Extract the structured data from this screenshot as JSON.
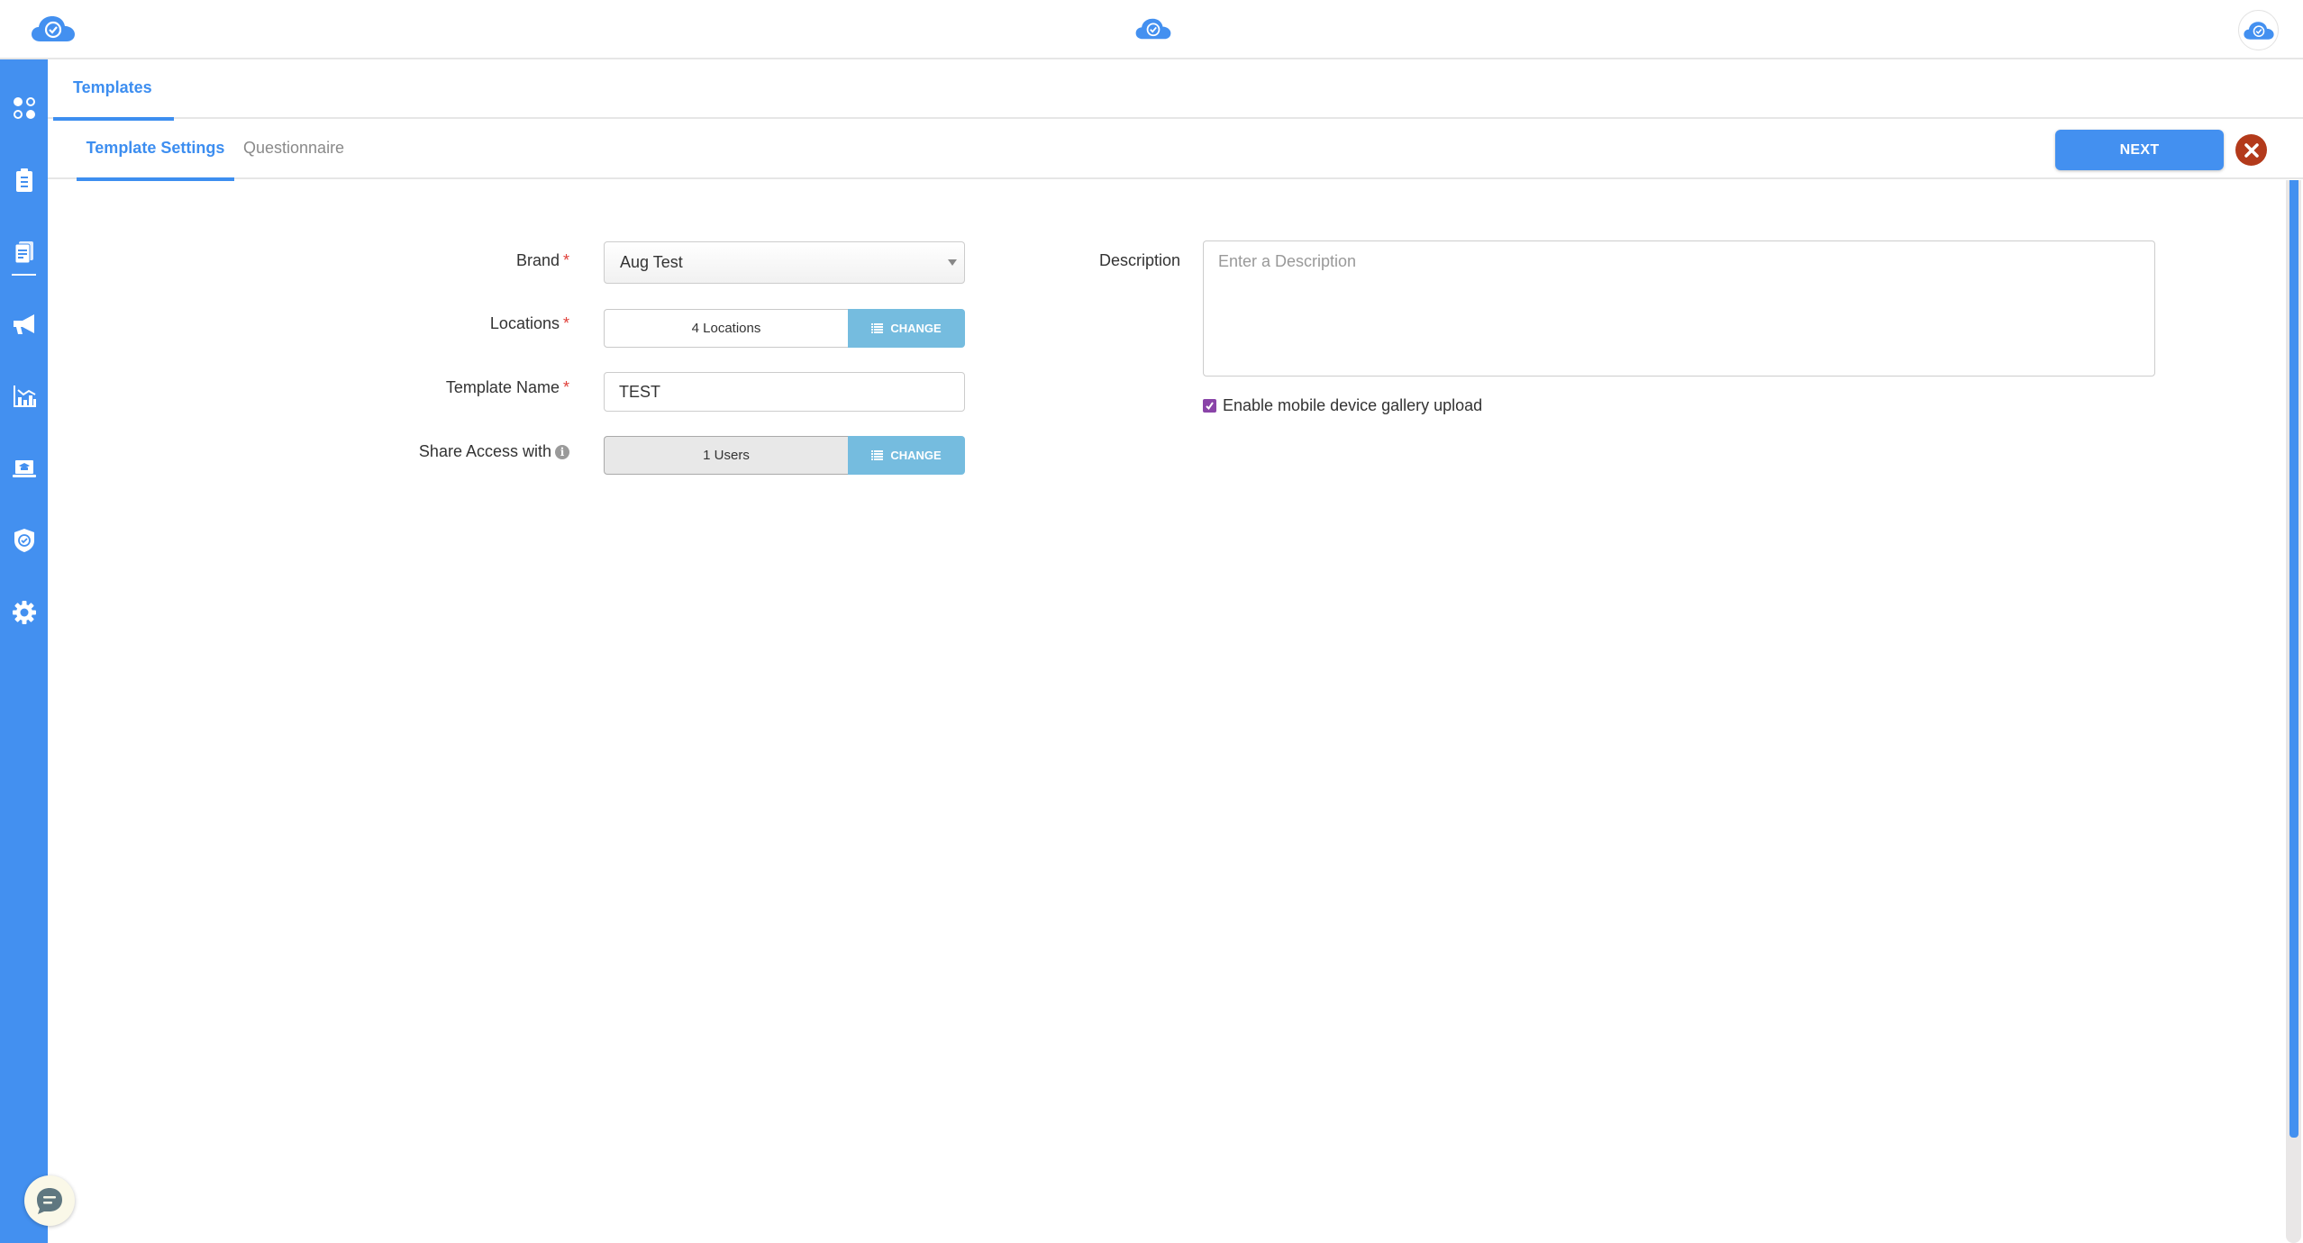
{
  "header": {
    "logo_icon": "cloud-check-logo",
    "center_logo_icon": "cloud-check-logo",
    "avatar_icon": "cloud-check-avatar"
  },
  "colors": {
    "brand_blue": "#4390f0",
    "tab_blue": "#3d8ef0",
    "change_button": "#75bcdf",
    "close_red": "#b33a1b",
    "checkbox_purple": "#8a44a8",
    "required_red": "#e0403a"
  },
  "sidebar": {
    "items": [
      {
        "icon": "dashboard-icon",
        "label": "Dashboard"
      },
      {
        "icon": "clipboard-icon",
        "label": "Audits"
      },
      {
        "icon": "documents-icon",
        "label": "Templates",
        "active": true
      },
      {
        "icon": "megaphone-icon",
        "label": "Announcements"
      },
      {
        "icon": "analytics-icon",
        "label": "Reports"
      },
      {
        "icon": "training-icon",
        "label": "Training"
      },
      {
        "icon": "shield-check-icon",
        "label": "Compliance"
      },
      {
        "icon": "gear-icon",
        "label": "Settings"
      }
    ]
  },
  "tabs": {
    "main": "Templates",
    "sub": [
      {
        "label": "Template Settings",
        "active": true
      },
      {
        "label": "Questionnaire",
        "active": false
      }
    ]
  },
  "actions": {
    "next_label": "NEXT",
    "close_icon": "close-icon"
  },
  "form": {
    "brand": {
      "label": "Brand",
      "required_mark": "*",
      "value": "Aug Test"
    },
    "locations": {
      "label": "Locations",
      "required_mark": "*",
      "value": "4 Locations",
      "change_label": "CHANGE"
    },
    "template_name": {
      "label": "Template Name",
      "required_mark": "*",
      "value": "TEST"
    },
    "share_access": {
      "label": "Share Access with",
      "info_icon": "i",
      "value": "1 Users",
      "change_label": "CHANGE"
    },
    "description": {
      "label": "Description",
      "value": "",
      "placeholder": "Enter a Description"
    },
    "gallery_upload": {
      "label": "Enable mobile device gallery upload",
      "checked": true
    }
  },
  "chat": {
    "icon": "chat-bubble-icon"
  }
}
